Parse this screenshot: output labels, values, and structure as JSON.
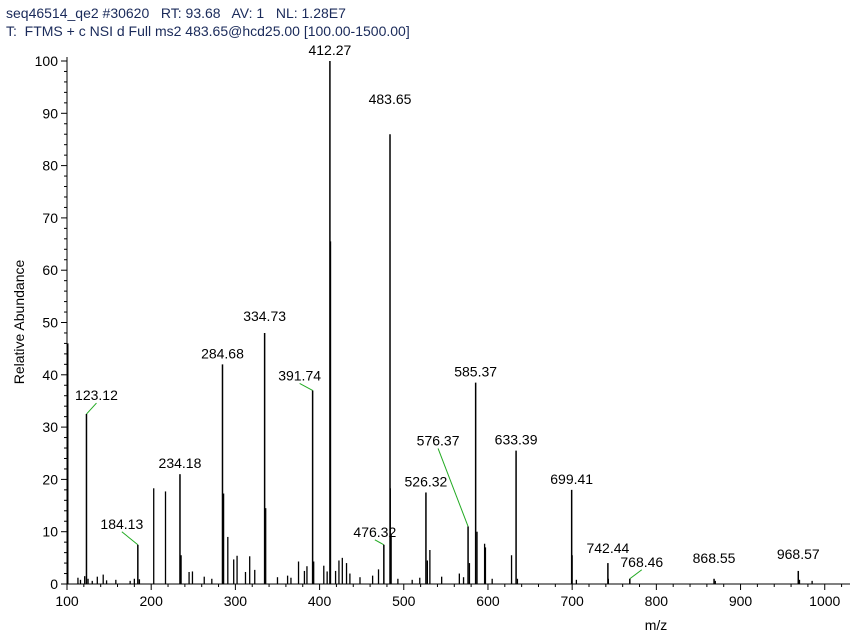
{
  "header": {
    "line1": "seq46514_qe2 #30620   RT: 93.68   AV: 1   NL: 1.28E7",
    "line2": "T:  FTMS + c NSI d Full ms2 483.65@hcd25.00 [100.00-1500.00]"
  },
  "chart_data": {
    "type": "bar",
    "xlabel": "m/z",
    "ylabel": "Relative Abundance",
    "xlim": [
      100,
      1030
    ],
    "ylim": [
      0,
      100
    ],
    "xticks": [
      100,
      200,
      300,
      400,
      500,
      600,
      700,
      800,
      900,
      1000
    ],
    "yticks": [
      0,
      10,
      20,
      30,
      40,
      50,
      60,
      70,
      80,
      90,
      100
    ],
    "grid": false,
    "labeled_peaks": [
      {
        "mz": 123.12,
        "label": "123.12",
        "value": 32.5
      },
      {
        "mz": 184.13,
        "label": "184.13",
        "value": 7.5
      },
      {
        "mz": 234.18,
        "label": "234.18",
        "value": 21.0
      },
      {
        "mz": 284.68,
        "label": "284.68",
        "value": 42.0
      },
      {
        "mz": 334.73,
        "label": "334.73",
        "value": 48.0
      },
      {
        "mz": 391.74,
        "label": "391.74",
        "value": 37.0
      },
      {
        "mz": 412.27,
        "label": "412.27",
        "value": 100.0
      },
      {
        "mz": 476.32,
        "label": "476.32",
        "value": 7.5
      },
      {
        "mz": 483.65,
        "label": "483.65",
        "value": 86.0
      },
      {
        "mz": 526.32,
        "label": "526.32",
        "value": 17.5
      },
      {
        "mz": 576.37,
        "label": "576.37",
        "value": 11.0
      },
      {
        "mz": 585.37,
        "label": "585.37",
        "value": 38.5
      },
      {
        "mz": 633.39,
        "label": "633.39",
        "value": 25.5
      },
      {
        "mz": 699.41,
        "label": "699.41",
        "value": 18.0
      },
      {
        "mz": 742.44,
        "label": "742.44",
        "value": 4.0
      },
      {
        "mz": 768.46,
        "label": "768.46",
        "value": 1.0
      },
      {
        "mz": 868.55,
        "label": "868.55",
        "value": 1.0
      },
      {
        "mz": 968.57,
        "label": "968.57",
        "value": 2.5
      }
    ],
    "minor_peaks": [
      {
        "mz": 101,
        "value": 46
      },
      {
        "mz": 113,
        "value": 1.2
      },
      {
        "mz": 116,
        "value": 0.8
      },
      {
        "mz": 121,
        "value": 1.5
      },
      {
        "mz": 125,
        "value": 1.0
      },
      {
        "mz": 130,
        "value": 0.6
      },
      {
        "mz": 136,
        "value": 1.4
      },
      {
        "mz": 143,
        "value": 1.8
      },
      {
        "mz": 147,
        "value": 0.7
      },
      {
        "mz": 158,
        "value": 0.8
      },
      {
        "mz": 175,
        "value": 0.6
      },
      {
        "mz": 180,
        "value": 1.0
      },
      {
        "mz": 186,
        "value": 0.9
      },
      {
        "mz": 203,
        "value": 18.3
      },
      {
        "mz": 217,
        "value": 17.7
      },
      {
        "mz": 235.5,
        "value": 5.5
      },
      {
        "mz": 245,
        "value": 2.3
      },
      {
        "mz": 249,
        "value": 2.4
      },
      {
        "mz": 263,
        "value": 1.4
      },
      {
        "mz": 272,
        "value": 1.0
      },
      {
        "mz": 286,
        "value": 17.3
      },
      {
        "mz": 291,
        "value": 9.0
      },
      {
        "mz": 298,
        "value": 4.7
      },
      {
        "mz": 302,
        "value": 5.4
      },
      {
        "mz": 312,
        "value": 2.3
      },
      {
        "mz": 317,
        "value": 5.3
      },
      {
        "mz": 323,
        "value": 2.7
      },
      {
        "mz": 336,
        "value": 14.5
      },
      {
        "mz": 350,
        "value": 1.3
      },
      {
        "mz": 362,
        "value": 1.6
      },
      {
        "mz": 366,
        "value": 1.2
      },
      {
        "mz": 375,
        "value": 4.3
      },
      {
        "mz": 382,
        "value": 2.5
      },
      {
        "mz": 385,
        "value": 3.4
      },
      {
        "mz": 393,
        "value": 4.3
      },
      {
        "mz": 405,
        "value": 3.5
      },
      {
        "mz": 409,
        "value": 2.4
      },
      {
        "mz": 413,
        "value": 65.5
      },
      {
        "mz": 419,
        "value": 2.5
      },
      {
        "mz": 423,
        "value": 4.5
      },
      {
        "mz": 427,
        "value": 5.0
      },
      {
        "mz": 432,
        "value": 4.0
      },
      {
        "mz": 436,
        "value": 2.0
      },
      {
        "mz": 448,
        "value": 1.3
      },
      {
        "mz": 463,
        "value": 1.6
      },
      {
        "mz": 470,
        "value": 2.8
      },
      {
        "mz": 484,
        "value": 18.3
      },
      {
        "mz": 485,
        "value": 9.5
      },
      {
        "mz": 493,
        "value": 1.0
      },
      {
        "mz": 510,
        "value": 0.8
      },
      {
        "mz": 519,
        "value": 1.2
      },
      {
        "mz": 528,
        "value": 4.5
      },
      {
        "mz": 531,
        "value": 6.5
      },
      {
        "mz": 545,
        "value": 1.4
      },
      {
        "mz": 566,
        "value": 2.0
      },
      {
        "mz": 571,
        "value": 1.3
      },
      {
        "mz": 578,
        "value": 4.0
      },
      {
        "mz": 587,
        "value": 10.0
      },
      {
        "mz": 596,
        "value": 7.7
      },
      {
        "mz": 597,
        "value": 7.0
      },
      {
        "mz": 605,
        "value": 1.0
      },
      {
        "mz": 628,
        "value": 5.5
      },
      {
        "mz": 635,
        "value": 1.0
      },
      {
        "mz": 700,
        "value": 5.5
      },
      {
        "mz": 705,
        "value": 0.8
      },
      {
        "mz": 743,
        "value": 1.0
      },
      {
        "mz": 870,
        "value": 0.6
      },
      {
        "mz": 970,
        "value": 0.8
      },
      {
        "mz": 985,
        "value": 0.6
      }
    ]
  },
  "colors": {
    "axis": "#000000",
    "peak": "#000000",
    "leader": "#22aa22"
  }
}
